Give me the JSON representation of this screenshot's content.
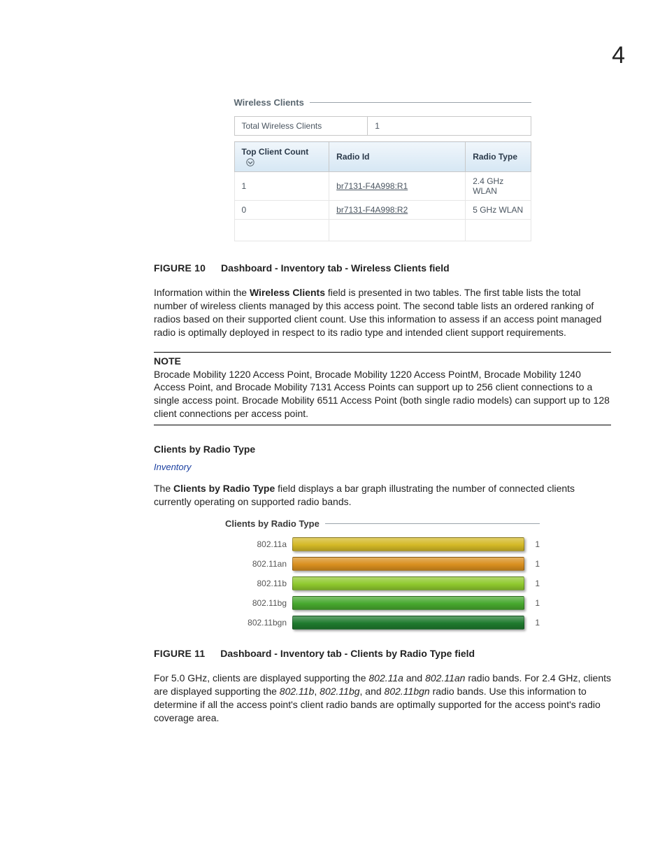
{
  "page_number": "4",
  "wc_panel": {
    "title": "Wireless Clients",
    "row1_label": "Total Wireless Clients",
    "row1_value": "1",
    "headers": {
      "c1": "Top Client Count",
      "c2": "Radio Id",
      "c3": "Radio Type"
    },
    "rows": [
      {
        "count": "1",
        "radio_id": "br7131-F4A998:R1",
        "radio_type": "2.4 GHz WLAN"
      },
      {
        "count": "0",
        "radio_id": "br7131-F4A998:R2",
        "radio_type": "5 GHz WLAN"
      }
    ]
  },
  "fig10": {
    "label": "FIGURE 10",
    "text": "Dashboard - Inventory tab - Wireless Clients field"
  },
  "para1_pre": "Information within the ",
  "para1_bold": "Wireless Clients",
  "para1_post": " field is presented in two tables. The first table lists the total number of wireless clients managed by this access point. The second table lists an ordered ranking of radios based on their supported client count. Use this information to assess if an access point managed radio is optimally deployed in respect to its radio type and intended client support requirements.",
  "note": {
    "label": "NOTE",
    "text": "Brocade Mobility 1220 Access Point, Brocade Mobility 1220 Access PointM, Brocade Mobility 1240 Access Point, and Brocade Mobility 7131 Access Points can support up to 256 client connections to a single access point. Brocade Mobility 6511 Access Point (both single radio models) can support up to 128 client connections per access point."
  },
  "section2": {
    "subhead": "Clients by Radio Type",
    "breadcrumb": "Inventory",
    "para_pre": "The ",
    "para_bold": "Clients by Radio Type",
    "para_post": " field displays a bar graph illustrating the number of connected clients currently operating on supported radio bands."
  },
  "chart_data": {
    "type": "bar",
    "title": "Clients by Radio Type",
    "categories": [
      "802.11a",
      "802.11an",
      "802.11b",
      "802.11bg",
      "802.11bgn"
    ],
    "values": [
      1,
      1,
      1,
      1,
      1
    ],
    "colors": [
      "#d4b926",
      "#d98f1f",
      "#8fc92e",
      "#47a82e",
      "#1f7a2e"
    ],
    "xlabel": "",
    "ylabel": "",
    "xlim": [
      0,
      1
    ]
  },
  "fig11": {
    "label": "FIGURE 11",
    "text": "Dashboard - Inventory tab - Clients by Radio Type field"
  },
  "para3": {
    "t1": "For 5.0 GHz, clients are displayed supporting the ",
    "i1": "802.11a",
    "t2": " and ",
    "i2": "802.11an",
    "t3": " radio bands. For 2.4 GHz, clients are displayed supporting the ",
    "i3": "802.11b",
    "t4": ", ",
    "i4": "802.11bg",
    "t5": ", and ",
    "i5": "802.11bgn",
    "t6": " radio bands. Use this information to determine if all the access point's client radio bands are optimally supported for the access point's radio coverage area."
  }
}
